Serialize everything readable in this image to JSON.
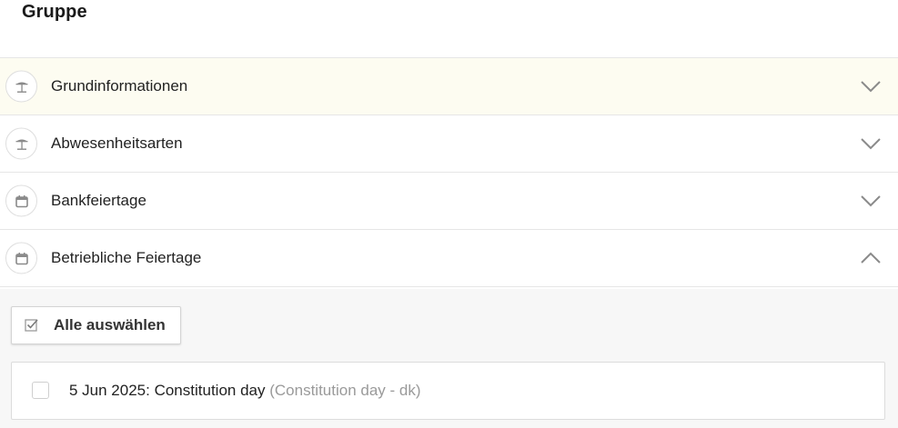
{
  "page": {
    "title": "Gruppe"
  },
  "sections": [
    {
      "label": "Grundinformationen",
      "icon": "beach-umbrella-icon",
      "expanded": false,
      "highlighted": true
    },
    {
      "label": "Abwesenheitsarten",
      "icon": "beach-umbrella-icon",
      "expanded": false,
      "highlighted": false
    },
    {
      "label": "Bankfeiertage",
      "icon": "calendar-icon",
      "expanded": false,
      "highlighted": false
    },
    {
      "label": "Betriebliche Feiertage",
      "icon": "calendar-icon",
      "expanded": true,
      "highlighted": false
    }
  ],
  "company_holidays": {
    "select_all_label": "Alle auswählen",
    "select_all_icon": "checkbox-checked-icon",
    "items": [
      {
        "date_name": "5 Jun 2025: Constitution day",
        "detail": "(Constitution day - dk)",
        "checked": false
      }
    ]
  },
  "colors": {
    "highlight_row": "#fdfcf1",
    "panel_background": "#f7f7f7",
    "icon_gray": "#8a8a8a",
    "muted_text": "#9a9a9a"
  }
}
